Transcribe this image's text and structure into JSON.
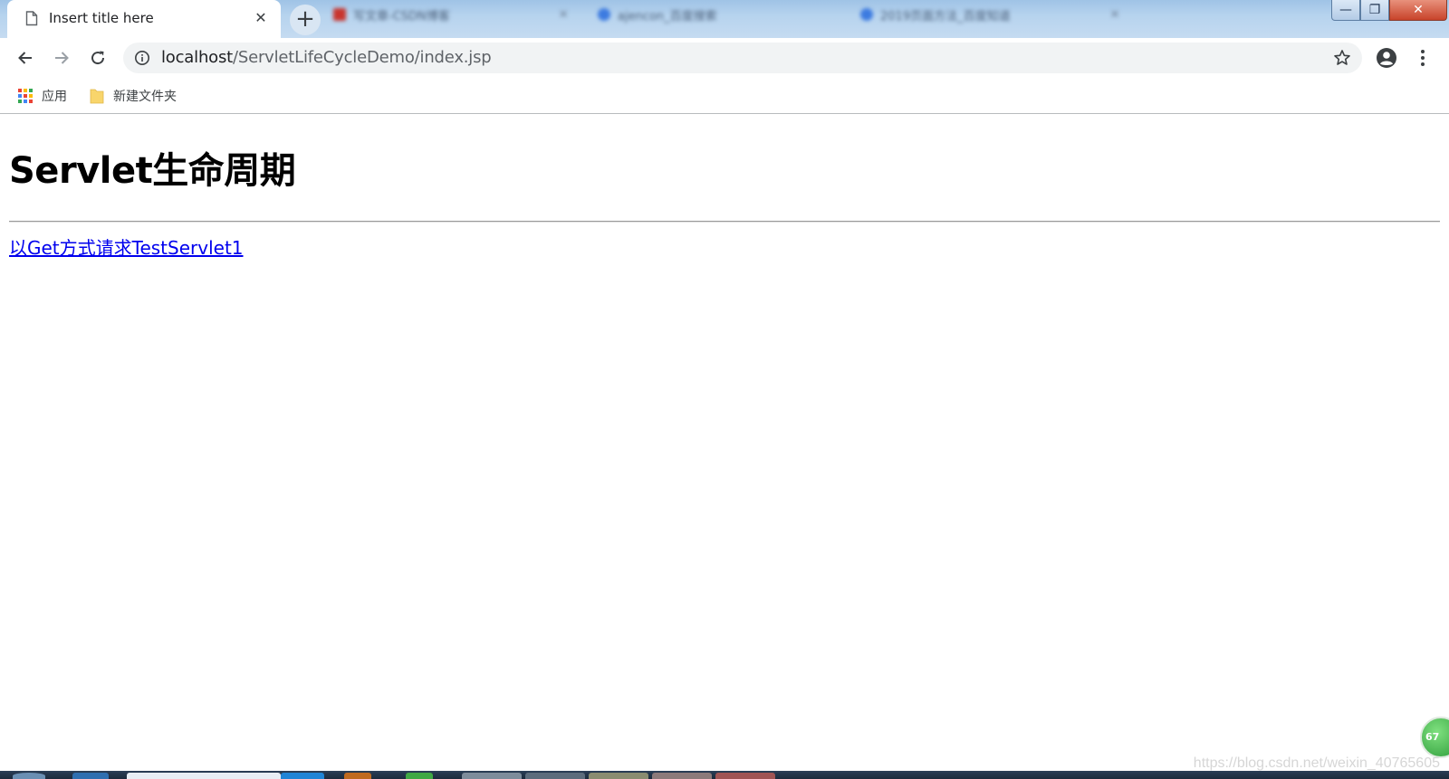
{
  "browser": {
    "active_tab": {
      "title": "Insert title here",
      "close_glyph": "✕"
    },
    "new_tab_glyph": "+",
    "background_tabs": [
      {
        "title": "写文章-CSDN博客",
        "favicon_color": "#c8352e"
      },
      {
        "title": "ajencon_百度搜索",
        "favicon_color": "#3d7be0"
      },
      {
        "title": "2019页面方法_百度知道",
        "favicon_color": "#3d7be0"
      }
    ],
    "window_controls": {
      "minimize": "—",
      "restore": "❐",
      "close": "✕"
    }
  },
  "toolbar": {
    "url_host": "localhost",
    "url_path": "/ServletLifeCycleDemo/index.jsp",
    "icons": [
      "back-arrow-icon",
      "forward-arrow-icon",
      "reload-icon",
      "info-icon",
      "star-icon",
      "account-icon",
      "menu-dots-icon"
    ]
  },
  "bookmarks": {
    "apps_label": "应用",
    "folder_label": "新建文件夹",
    "apps_colors": [
      "#ea4335",
      "#fbbc05",
      "#34a853",
      "#4285f4",
      "#ea4335",
      "#fbbc05",
      "#34a853",
      "#4285f4",
      "#ea4335"
    ],
    "folder_color": "#f8d56b"
  },
  "page": {
    "heading": "Servlet生命周期",
    "link_text": "以Get方式请求TestServlet1"
  },
  "overlay": {
    "watermark": "https://blog.csdn.net/weixin_40765605",
    "badge_text": "67"
  }
}
